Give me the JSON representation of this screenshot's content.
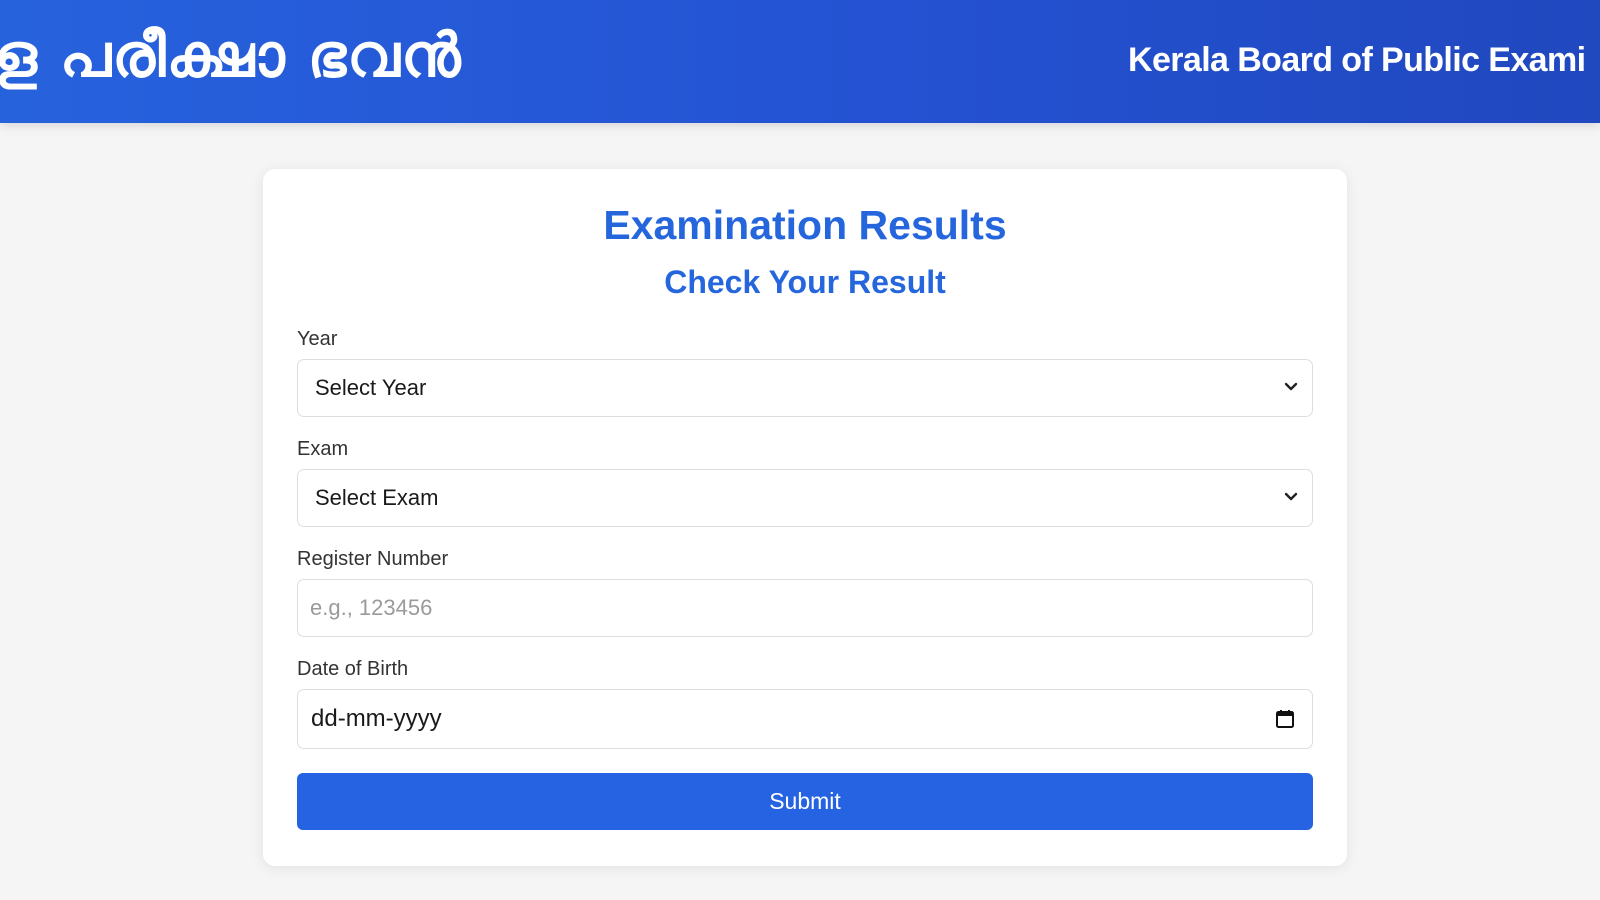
{
  "header": {
    "title_malayalam": "ള പരീക്ഷാ ഭവൻ",
    "title_english": "Kerala Board of Public Exami"
  },
  "card": {
    "title": "Examination Results",
    "subtitle": "Check Your Result"
  },
  "form": {
    "year": {
      "label": "Year",
      "selected": "Select Year"
    },
    "exam": {
      "label": "Exam",
      "selected": "Select Exam"
    },
    "register_number": {
      "label": "Register Number",
      "placeholder": "e.g., 123456",
      "value": ""
    },
    "date_of_birth": {
      "label": "Date of Birth",
      "value": "dd-mm-yyyy"
    },
    "submit_label": "Submit"
  },
  "colors": {
    "header_bg": "#2452d2",
    "accent": "#2566dd",
    "button_bg": "#2663e3",
    "page_bg": "#f5f5f6"
  },
  "icons": {
    "select_arrow": "chevron-down-icon",
    "date_picker": "calendar-icon"
  }
}
